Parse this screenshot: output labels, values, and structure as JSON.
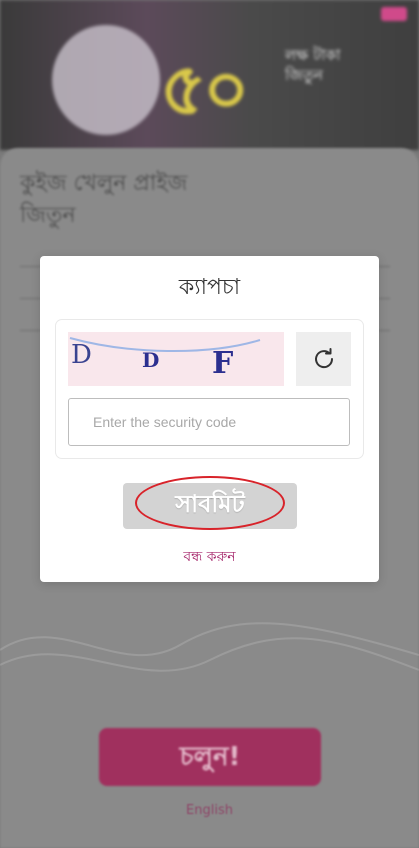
{
  "background": {
    "banner_number": "৫০",
    "banner_side_text": "লক্ষ টাকা জিতুন",
    "card_heading": "কুইজ খেলুন প্রাইজ জিতুন",
    "cta_label": "চলুন!",
    "language_link": "English"
  },
  "modal": {
    "title": "ক্যাপচা",
    "captcha_chars": [
      "D",
      "D",
      "F"
    ],
    "input_placeholder": "Enter the security code",
    "input_value": "",
    "submit_label": "সাবমিট",
    "close_label": "বন্ধ করুন"
  },
  "colors": {
    "accent": "#a6266b",
    "highlight": "#d8232a",
    "captcha_bg": "#f9e7ec",
    "captcha_text": "#2c2f8f"
  },
  "icons": {
    "refresh": "refresh-icon"
  }
}
